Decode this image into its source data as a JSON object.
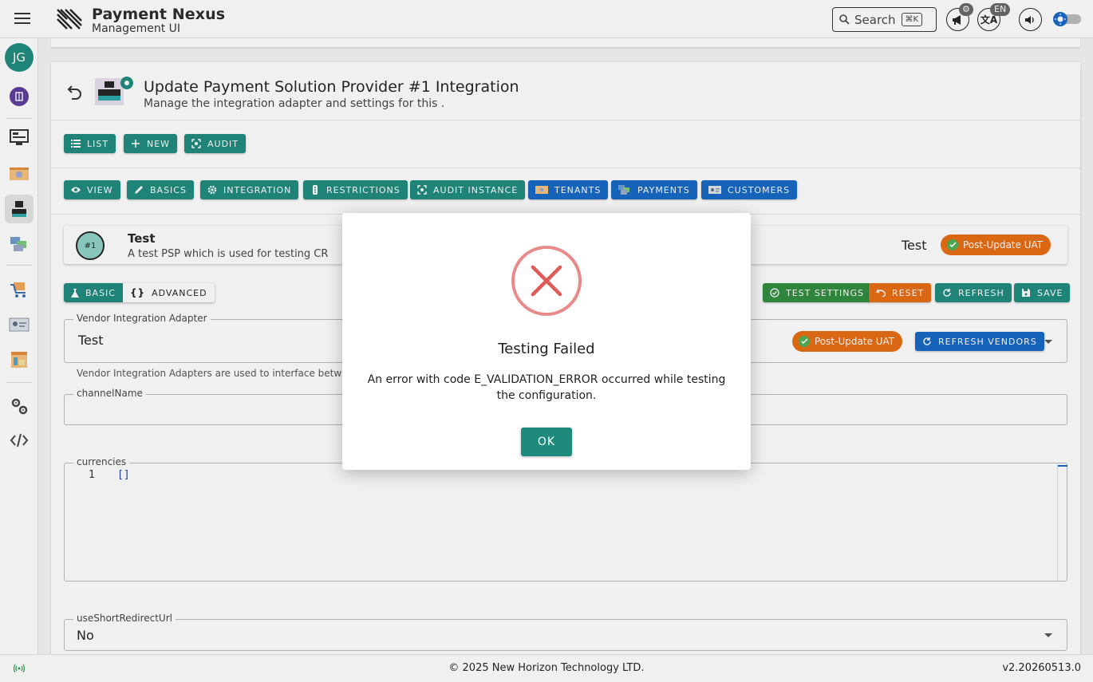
{
  "header": {
    "brand_title": "Payment Nexus",
    "brand_subtitle": "Management UI",
    "search_label": "Search",
    "search_shortcut": "⌘K",
    "language": "EN"
  },
  "sidebar": {
    "avatar_initials": "JG"
  },
  "page": {
    "title": "Update Payment Solution Provider #1 Integration",
    "subtitle": "Manage the integration adapter and settings for this ."
  },
  "toolbar": {
    "list": "LIST",
    "new": "NEW",
    "audit": "AUDIT"
  },
  "tabs": {
    "view": "VIEW",
    "basics": "BASICS",
    "integration": "INTEGRATION",
    "restrictions": "RESTRICTIONS",
    "audit_instance": "AUDIT INSTANCE",
    "tenants": "TENANTS",
    "payments": "PAYMENTS",
    "customers": "CUSTOMERS"
  },
  "record": {
    "number": "#1",
    "name": "Test",
    "description": "A test PSP which is used for testing CR",
    "right_name": "Test",
    "status_pill": "Post-Update UAT"
  },
  "mode": {
    "basic": "BASIC",
    "advanced": "ADVANCED"
  },
  "actions": {
    "test_settings": "TEST SETTINGS",
    "reset": "RESET",
    "refresh": "REFRESH",
    "save": "SAVE"
  },
  "form": {
    "adapter_label": "Vendor Integration Adapter",
    "adapter_value": "Test",
    "adapter_pill": "Post-Update UAT",
    "refresh_vendors": "REFRESH VENDORS",
    "adapter_helper": "Vendor Integration Adapters are used to interface betw",
    "channel_label": "channelName",
    "channel_value": "",
    "currencies_label": "currencies",
    "currencies_line": "1",
    "currencies_value": "[]",
    "short_redirect_label": "useShortRedirectUrl",
    "short_redirect_value": "No"
  },
  "dialog": {
    "title": "Testing Failed",
    "message": "An error with code E_VALIDATION_ERROR occurred while testing the configuration.",
    "ok": "OK"
  },
  "footer": {
    "copyright": "© 2025 New Horizon Technology LTD.",
    "version": "v2.20260513.0"
  },
  "colors": {
    "teal": "#1d8a7c",
    "blue": "#1467c4",
    "green": "#2f8b3d",
    "orange": "#e86b10",
    "error_red": "#e05a5a"
  }
}
